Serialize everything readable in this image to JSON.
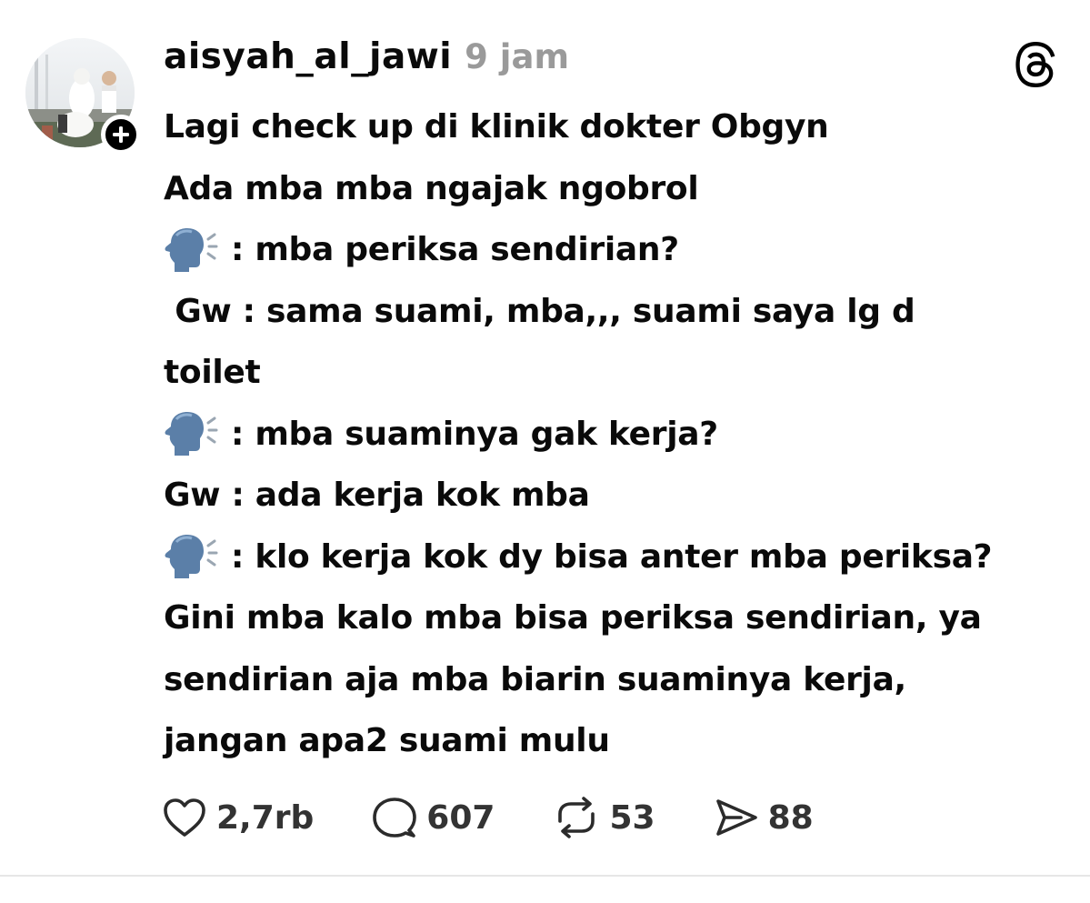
{
  "post": {
    "username": "aisyah_al_jawi",
    "time": "9 jam",
    "avatar_icon": "profile-photo",
    "follow_icon": "plus-icon",
    "platform_icon": "threads-logo-icon",
    "lines": [
      {
        "icon": null,
        "text": "Lagi check up di klinik dokter Obgyn"
      },
      {
        "icon": null,
        "text": "Ada mba mba ngajak ngobrol"
      },
      {
        "icon": "speaking-head-icon",
        "text": ": mba periksa sendirian?"
      },
      {
        "icon": null,
        "text": " Gw : sama suami, mba,,, suami saya lg d"
      },
      {
        "icon": null,
        "text": "toilet"
      },
      {
        "icon": "speaking-head-icon",
        "text": ": mba suaminya gak kerja?"
      },
      {
        "icon": null,
        "text": "Gw : ada kerja kok mba"
      },
      {
        "icon": "speaking-head-icon",
        "text": ": klo kerja kok dy bisa anter mba periksa?"
      },
      {
        "icon": null,
        "text": "Gini mba kalo mba bisa periksa sendirian, ya"
      },
      {
        "icon": null,
        "text": "sendirian aja mba biarin suaminya kerja,"
      },
      {
        "icon": null,
        "text": "jangan apa2 suami mulu"
      }
    ],
    "actions": {
      "like": {
        "icon": "heart-icon",
        "count": "2,7rb"
      },
      "reply": {
        "icon": "comment-icon",
        "count": "607"
      },
      "repost": {
        "icon": "repost-icon",
        "count": "53"
      },
      "share": {
        "icon": "send-icon",
        "count": "88"
      }
    }
  }
}
